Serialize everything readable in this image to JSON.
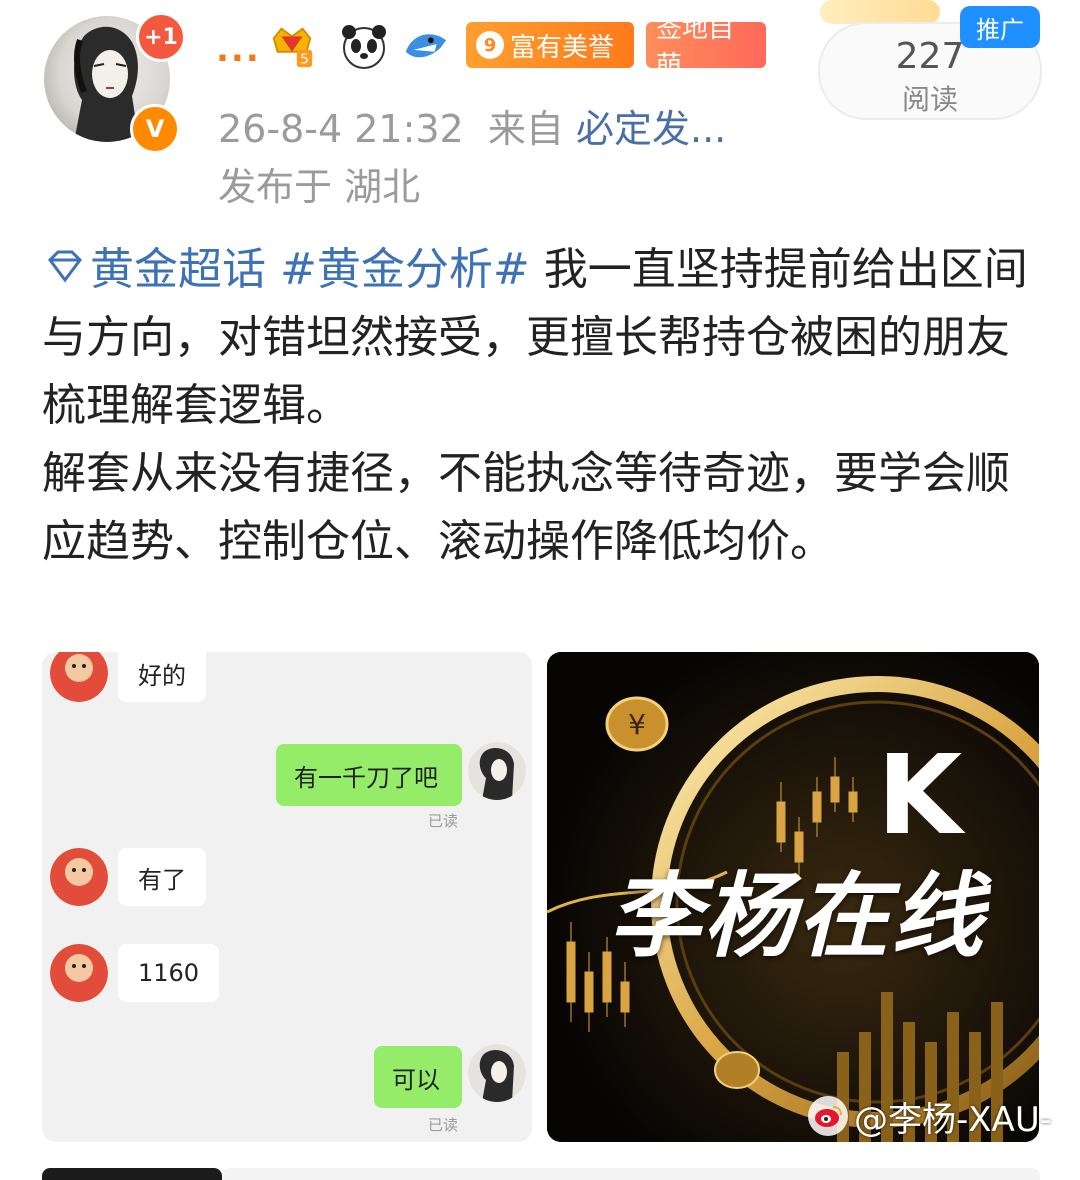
{
  "header": {
    "name_truncated": "...",
    "notification_count": "+1",
    "verified_mark": "V",
    "level_badge": "5",
    "tags": {
      "rich_level": "9",
      "rich_label": "富有美誉",
      "sign_label": "签地自萌"
    },
    "meta_line": {
      "time": "26-8-4 21:32",
      "from_label": "来自",
      "source": "必定发..."
    },
    "location": "发布于 湖北",
    "read_count": "227",
    "read_label": "阅读",
    "promo_label": "推广"
  },
  "post": {
    "topic1": "黄金超话",
    "topic2": "#黄金分析#",
    "para1": " 我一直坚持提前给出区间与方向，对错坦然接受，更擅长帮持仓被困的朋友梳理解套逻辑。",
    "para2": "解套从来没有捷径，不能执念等待奇迹，要学会顺应趋势、控制仓位、滚动操作降低均价。"
  },
  "chat": {
    "msg1": "好的",
    "msg2": "有一千刀了吧",
    "msg2_read": "已读",
    "msg3": "有了",
    "msg4": "1160",
    "msg5": "可以",
    "msg5_read": "已读"
  },
  "brand_image": {
    "letter": "K",
    "title": "李杨在线"
  },
  "watermark": {
    "text": "@李杨-XAU-"
  },
  "colors": {
    "link_blue": "#3d72b4",
    "meta_gray": "#9b9b9b",
    "chat_green": "#95ec69",
    "badge_red": "#f4593f",
    "promo_blue": "#1e90ff",
    "gold": "#d9a441"
  },
  "icons": [
    "crown-badge-icon",
    "panda-icon",
    "shark-icon",
    "diamond-topic-icon",
    "verified-icon",
    "weibo-logo-icon"
  ]
}
